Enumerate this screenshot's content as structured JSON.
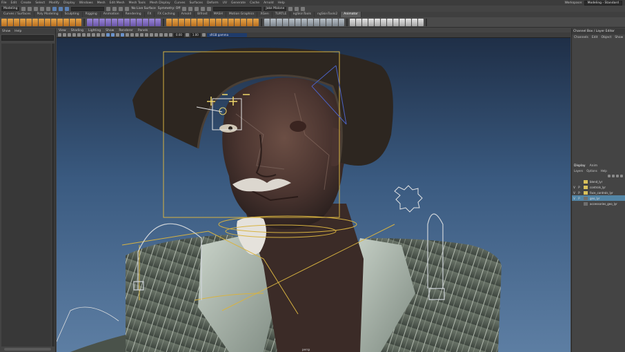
{
  "menubar": {
    "items": [
      "File",
      "Edit",
      "Create",
      "Select",
      "Modify",
      "Display",
      "Windows",
      "Mesh",
      "Edit Mesh",
      "Mesh Tools",
      "Mesh Display",
      "Curves",
      "Surfaces",
      "Deform",
      "UV",
      "Generate",
      "Cache",
      "Arnold",
      "Help"
    ],
    "workspace_label": "Workspace:",
    "workspace_value": "Modeling - Standard"
  },
  "statusline": {
    "mode": "Modeling",
    "live_surface": "No Live Surface",
    "symmetry": "Symmetry: Off",
    "sign_in": "Jake Malone"
  },
  "shelf_tabs": [
    {
      "label": "Curves / Surfaces",
      "active": false
    },
    {
      "label": "Poly Modeling",
      "active": false
    },
    {
      "label": "Sculpting",
      "active": false
    },
    {
      "label": "Rigging",
      "active": false
    },
    {
      "label": "Animation",
      "active": false
    },
    {
      "label": "Rendering",
      "active": false
    },
    {
      "label": "FX",
      "active": false
    },
    {
      "label": "FX Caching",
      "active": false
    },
    {
      "label": "Arnold",
      "active": false
    },
    {
      "label": "Bifrost",
      "active": false
    },
    {
      "label": "MASH",
      "active": false
    },
    {
      "label": "Motion Graphics",
      "active": false
    },
    {
      "label": "XGen",
      "active": false
    },
    {
      "label": "TURTLE",
      "active": false
    },
    {
      "label": "ngSkinTools",
      "active": false
    },
    {
      "label": "ngSkinTools2",
      "active": false
    },
    {
      "label": "Animator",
      "active": true
    }
  ],
  "outliner": {
    "menu": [
      "Show",
      "Help"
    ]
  },
  "viewport": {
    "menu": [
      "View",
      "Shading",
      "Lighting",
      "Show",
      "Renderer",
      "Panels"
    ],
    "near": "0.00",
    "far": "1.00",
    "color_space": "sRGB gamma",
    "camera_label": "persp"
  },
  "right_panel": {
    "title": "Channel Box / Layer Editor",
    "menu": [
      "Channels",
      "Edit",
      "Object",
      "Show"
    ],
    "layer_tabs": [
      "Display",
      "Anim"
    ],
    "layer_menu": [
      "Layers",
      "Options",
      "Help"
    ],
    "layers": [
      {
        "v": "",
        "p": "",
        "color": "#d9c05a",
        "name": "blend_lyr",
        "selected": false
      },
      {
        "v": "V",
        "p": "P",
        "color": "#d9c05a",
        "name": "controls_lyr",
        "selected": false
      },
      {
        "v": "V",
        "p": "P",
        "color": "#d9c05a",
        "name": "face_controls_lyr",
        "selected": false
      },
      {
        "v": "V",
        "p": "P",
        "color": "#6e6e6e",
        "name": "geo_lyr",
        "selected": true
      },
      {
        "v": "",
        "p": "",
        "color": "#6e6e6e",
        "name": "accessories_geo_lyr",
        "selected": false
      }
    ]
  }
}
